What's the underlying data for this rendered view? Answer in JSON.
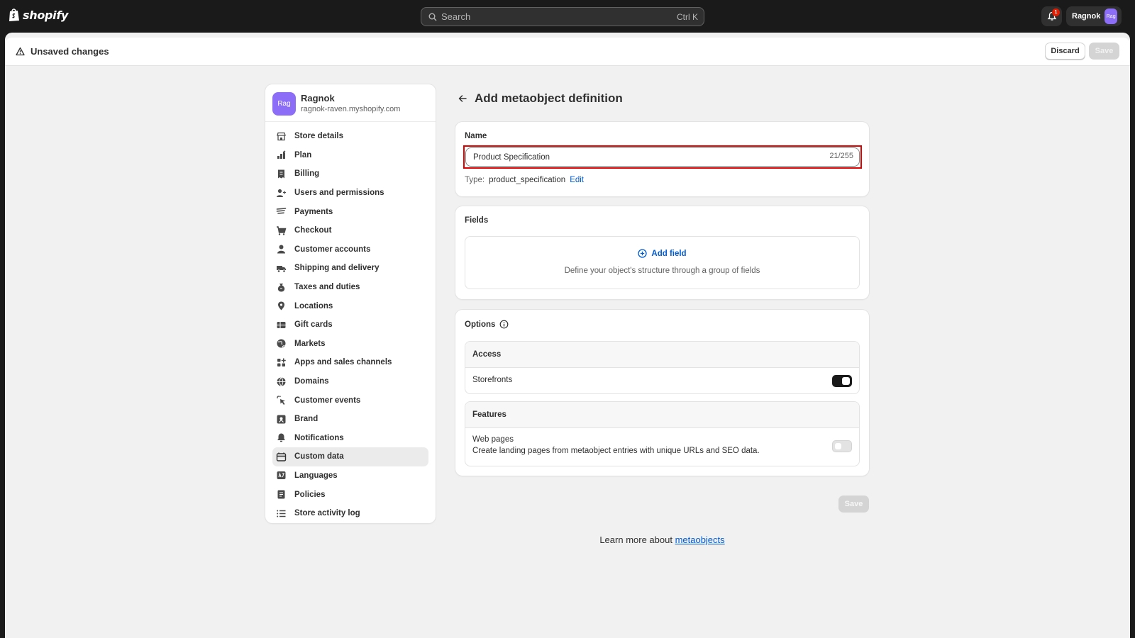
{
  "brand": {
    "name": "shopify"
  },
  "search": {
    "placeholder": "Search",
    "shortcut": "Ctrl K"
  },
  "notifications": {
    "count": "1"
  },
  "user": {
    "name": "Ragnok",
    "avatar_initials": "Rag"
  },
  "savebar": {
    "title": "Unsaved changes",
    "discard_label": "Discard",
    "save_label": "Save"
  },
  "store": {
    "avatar_initials": "Rag",
    "name": "Ragnok",
    "url": "ragnok-raven.myshopify.com"
  },
  "sidebar": {
    "items": [
      {
        "label": "Store details",
        "icon": "store-icon"
      },
      {
        "label": "Plan",
        "icon": "plan-icon"
      },
      {
        "label": "Billing",
        "icon": "billing-icon"
      },
      {
        "label": "Users and permissions",
        "icon": "users-icon"
      },
      {
        "label": "Payments",
        "icon": "payments-icon"
      },
      {
        "label": "Checkout",
        "icon": "cart-icon"
      },
      {
        "label": "Customer accounts",
        "icon": "person-icon"
      },
      {
        "label": "Shipping and delivery",
        "icon": "truck-icon"
      },
      {
        "label": "Taxes and duties",
        "icon": "tax-bag-icon"
      },
      {
        "label": "Locations",
        "icon": "location-pin-icon"
      },
      {
        "label": "Gift cards",
        "icon": "gift-card-icon"
      },
      {
        "label": "Markets",
        "icon": "globe-icon"
      },
      {
        "label": "Apps and sales channels",
        "icon": "apps-icon"
      },
      {
        "label": "Domains",
        "icon": "domain-globe-icon"
      },
      {
        "label": "Customer events",
        "icon": "cursor-click-icon"
      },
      {
        "label": "Brand",
        "icon": "brand-icon"
      },
      {
        "label": "Notifications",
        "icon": "bell-icon"
      },
      {
        "label": "Custom data",
        "icon": "custom-data-icon",
        "active": true
      },
      {
        "label": "Languages",
        "icon": "languages-icon"
      },
      {
        "label": "Policies",
        "icon": "policies-icon"
      },
      {
        "label": "Store activity log",
        "icon": "list-icon"
      }
    ]
  },
  "page": {
    "title": "Add metaobject definition"
  },
  "name_card": {
    "label": "Name",
    "value": "Product Specification",
    "char_count": "21/255",
    "type_label": "Type:",
    "type_value": "product_specification",
    "edit_label": "Edit"
  },
  "fields_card": {
    "label": "Fields",
    "add_label": "Add field",
    "description": "Define your object's structure through a group of fields"
  },
  "options_card": {
    "label": "Options",
    "access": {
      "heading": "Access",
      "storefronts_label": "Storefronts",
      "storefronts_enabled": true
    },
    "features": {
      "heading": "Features",
      "web_pages_label": "Web pages",
      "web_pages_description": "Create landing pages from metaobject entries with unique URLs and SEO data.",
      "web_pages_enabled": false
    }
  },
  "footer": {
    "save_label": "Save",
    "learn_prefix": "Learn more about ",
    "learn_link": "metaobjects"
  },
  "colors": {
    "accent": "#005bd3",
    "highlight": "#e00000",
    "avatar": "#8c6df7",
    "topbar": "#1a1a1a"
  }
}
